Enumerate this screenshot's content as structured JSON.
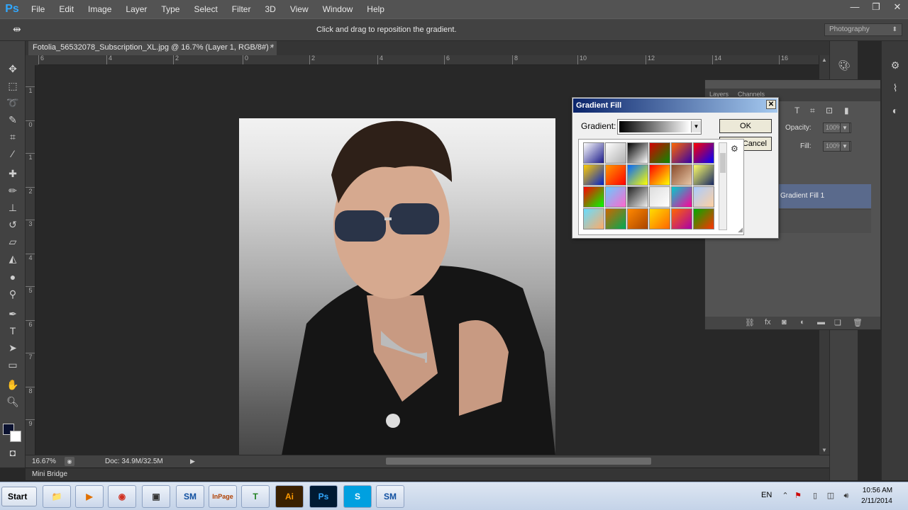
{
  "app": {
    "logo": "Ps"
  },
  "menu": [
    "File",
    "Edit",
    "Image",
    "Layer",
    "Type",
    "Select",
    "Filter",
    "3D",
    "View",
    "Window",
    "Help"
  ],
  "window_controls": {
    "minimize": "—",
    "restore": "❐",
    "close": "✕"
  },
  "options_bar": {
    "hint": "Click and drag to reposition the gradient.",
    "workspace": "Photography",
    "tool_preset_icon": "move-tool-icon"
  },
  "document": {
    "tab_title": "Fotolia_56532078_Subscription_XL.jpg @ 16.7% (Layer 1, RGB/8#) *",
    "tab_close": "×"
  },
  "rulers": {
    "h": [
      "6",
      "4",
      "2",
      "0",
      "2",
      "4",
      "6",
      "8",
      "10",
      "12",
      "14",
      "16",
      "18"
    ],
    "v": [
      "1",
      "0",
      "1",
      "2",
      "3",
      "4",
      "5",
      "6",
      "7",
      "8",
      "9"
    ]
  },
  "status": {
    "zoom": "16.67%",
    "doc": "Doc: 34.9M/32.5M"
  },
  "mini_bridge": {
    "label": "Mini Bridge"
  },
  "layers_panel": {
    "tabs": [
      "Layers",
      "Channels"
    ],
    "opacity_label": "Opacity:",
    "opacity_value": "100%",
    "fill_label": "Fill:",
    "fill_value": "100%",
    "selected_layer": "Gradient Fill 1"
  },
  "gradient_dialog": {
    "title": "Gradient Fill",
    "gradient_label": "Gradient:",
    "ok": "OK",
    "cancel": "Cancel",
    "swatches": [
      [
        "#ffffff",
        "#1a1a8a"
      ],
      [
        "#ffffff",
        "#b0b0b0"
      ],
      [
        "#000000",
        "#ffffff"
      ],
      [
        "#d40000",
        "#0a8a00"
      ],
      [
        "#ff6600",
        "#3300aa"
      ],
      [
        "#ff0000",
        "#0000ff"
      ],
      [
        "#ffcc00",
        "#0022cc"
      ],
      [
        "#ff9900",
        "#ff0000"
      ],
      [
        "#0066ff",
        "#ffff00"
      ],
      [
        "#ff0000",
        "#ffff00"
      ],
      [
        "#8a4a2a",
        "#e8c8a8"
      ],
      [
        "#ffff66",
        "#1a2a66"
      ],
      [
        "#ff0000",
        "#00ff00"
      ],
      [
        "#66ccff",
        "#ff66cc"
      ],
      [
        "#222222",
        "#eeeeee"
      ],
      [
        "#dddddd",
        "#ffffff"
      ],
      [
        "#00cccc",
        "#ff0099"
      ],
      [
        "#aaccff",
        "#ffd0a0"
      ],
      [
        "#66ddff",
        "#ffaa66"
      ],
      [
        "#cc6600",
        "#00aa55"
      ],
      [
        "#ff8800",
        "#aa4400"
      ],
      [
        "#ffdd00",
        "#ff6600"
      ],
      [
        "#ff6600",
        "#aa00aa"
      ],
      [
        "#00aa00",
        "#ff3300"
      ]
    ]
  },
  "taskbar": {
    "start": "Start",
    "apps": [
      "📁",
      "▶",
      "◉",
      "▣",
      "SM",
      "InPage",
      "T",
      "Ai",
      "Ps",
      "S",
      "SM"
    ],
    "lang": "EN",
    "time": "10:56 AM",
    "date": "2/11/2014"
  }
}
